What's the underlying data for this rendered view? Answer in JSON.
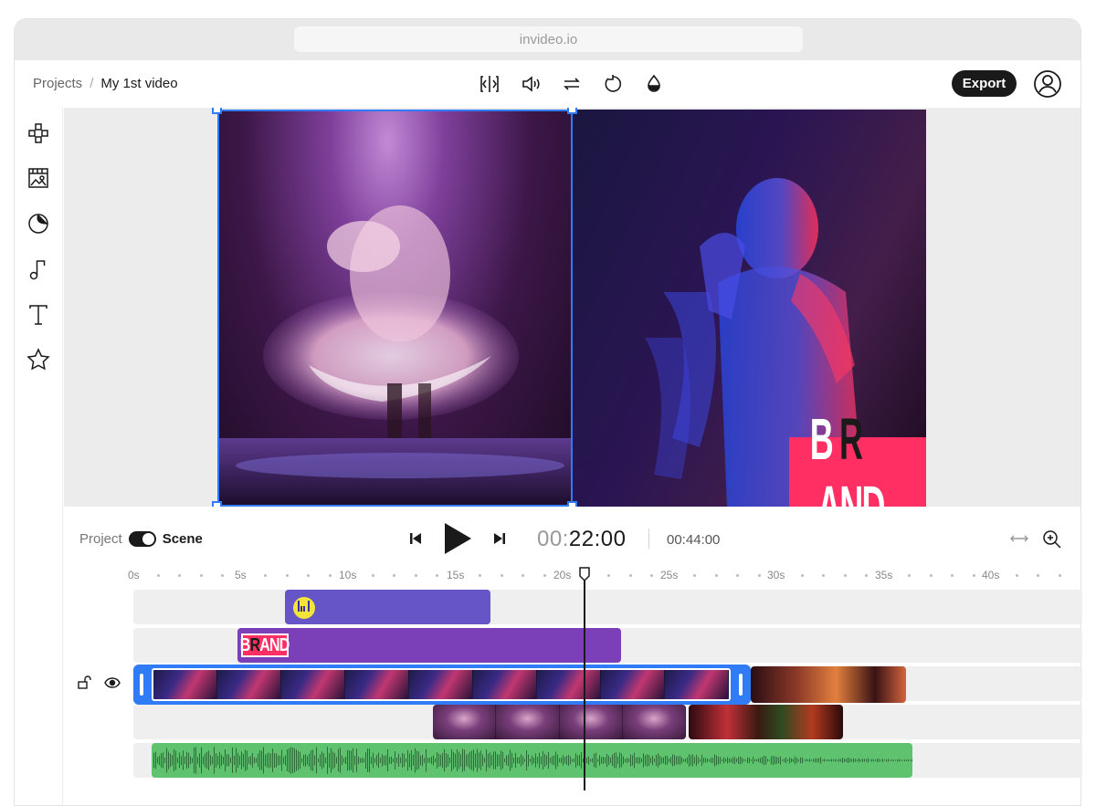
{
  "browser": {
    "url": "invideo.io"
  },
  "breadcrumb": {
    "root": "Projects",
    "separator": "/",
    "current": "My 1st video"
  },
  "toolbar": {
    "tools": [
      "split-icon",
      "volume-icon",
      "swap-icon",
      "rotate-icon",
      "color-drop-icon"
    ],
    "export_label": "Export"
  },
  "sidebar": {
    "items": [
      "layout-icon",
      "media-icon",
      "sticker-icon",
      "music-icon",
      "text-icon",
      "star-icon"
    ]
  },
  "preview": {
    "brand_text_1": "B",
    "brand_text_2": "R",
    "brand_text_3": "AND"
  },
  "controls": {
    "project_label": "Project",
    "scene_label": "Scene",
    "time_dim": "00:",
    "time_main": "22:00",
    "total_time": "00:44:00"
  },
  "ruler": {
    "labels": [
      "0s",
      "5s",
      "10s",
      "15s",
      "20s",
      "25s",
      "30s",
      "35s",
      "40s"
    ],
    "playhead_time_s": 21
  },
  "tracks": {
    "brand_clip_text_1": "B",
    "brand_clip_text_2": "R",
    "brand_clip_text_3": "AND"
  },
  "colors": {
    "accent": "#2f7cf6",
    "brand": "#ff2e63",
    "sticker_track": "#6655c6",
    "brand_track": "#7b3fb7",
    "audio_track": "#5ec26e"
  }
}
